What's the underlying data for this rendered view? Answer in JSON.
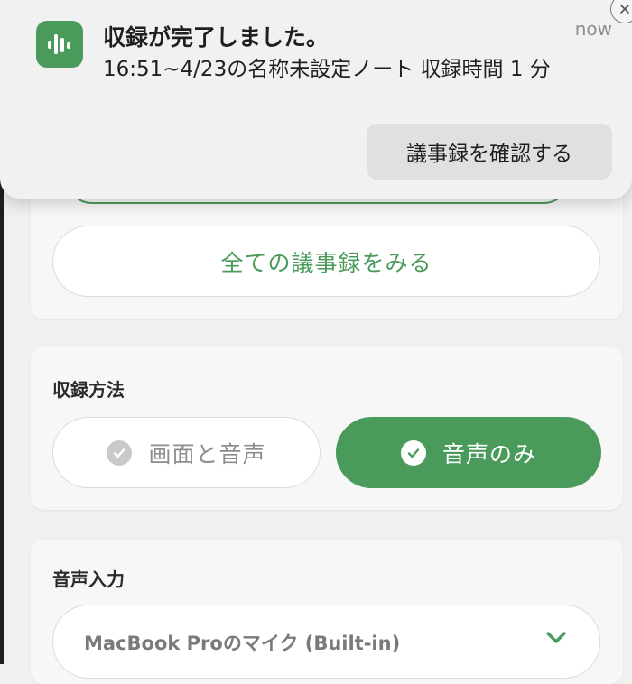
{
  "notification": {
    "title": "収録が完了しました。",
    "time": "now",
    "body": "16:51~4/23の名称未設定ノート 収録時間 1 分",
    "action_label": "議事録を確認する",
    "app_icon": "waveform-icon",
    "close_icon": "close-icon"
  },
  "main": {
    "all_minutes_label": "全ての議事録をみる",
    "recording_method": {
      "title": "収録方法",
      "options": [
        {
          "label": "画面と音声",
          "selected": false
        },
        {
          "label": "音声のみ",
          "selected": true
        }
      ]
    },
    "audio_input": {
      "title": "音声入力",
      "selected": "MacBook Proのマイク (Built-in)",
      "icon": "chevron-down-icon"
    }
  },
  "colors": {
    "accent": "#4a9a5c",
    "panel": "#f7f7f7",
    "notification_bg": "#f1f1f1"
  }
}
